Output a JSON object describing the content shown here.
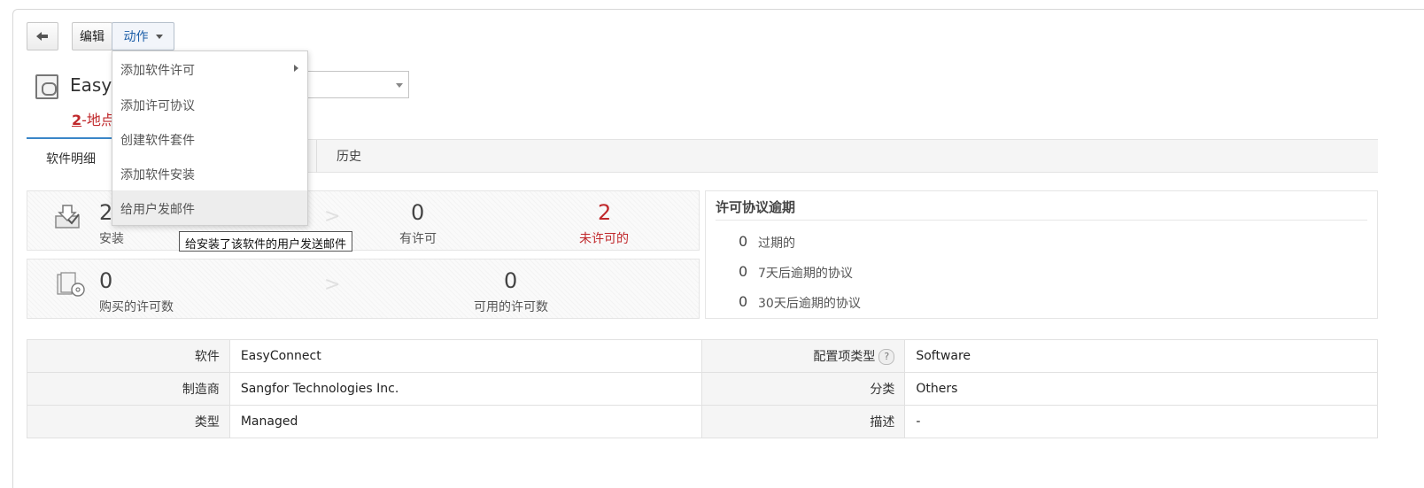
{
  "toolbar": {
    "edit_label": "编辑",
    "action_label": "动作"
  },
  "header": {
    "title": "EasyConnect",
    "sites_count": "2",
    "sites_suffix": "-地点"
  },
  "tabs": {
    "details": "软件明细",
    "history": "历史"
  },
  "install_panel": {
    "installs_value": "2",
    "installs_label": "安装",
    "licensed_value": "0",
    "licensed_label": "有许可",
    "unlicensed_value": "2",
    "unlicensed_label": "未许可的"
  },
  "license_panel": {
    "purchased_value": "0",
    "purchased_label": "购买的许可数",
    "available_value": "0",
    "available_label": "可用的许可数"
  },
  "expiry_panel": {
    "title": "许可协议逾期",
    "rows": [
      {
        "count": "0",
        "label": "过期的"
      },
      {
        "count": "0",
        "label": "7天后逾期的协议"
      },
      {
        "count": "0",
        "label": "30天后逾期的协议"
      }
    ]
  },
  "details": {
    "software_label": "软件",
    "software_value": "EasyConnect",
    "ci_type_label": "配置项类型",
    "ci_type_value": "Software",
    "help_glyph": "?",
    "manufacturer_label": "制造商",
    "manufacturer_value": "Sangfor Technologies Inc.",
    "category_label": "分类",
    "category_value": "Others",
    "type_label": "类型",
    "type_value": "Managed",
    "description_label": "描述",
    "description_value": "-"
  },
  "action_menu": {
    "items": [
      {
        "label": "添加软件许可"
      },
      {
        "label": "添加许可协议"
      },
      {
        "label": "创建软件套件"
      },
      {
        "label": "添加软件安装"
      },
      {
        "label": "给用户发邮件"
      }
    ],
    "tooltip": "给安装了该软件的用户发送邮件"
  },
  "colors": {
    "accent": "#3a86c8",
    "alert_red": "#c0282b",
    "link_blue": "#1d5fa8"
  }
}
